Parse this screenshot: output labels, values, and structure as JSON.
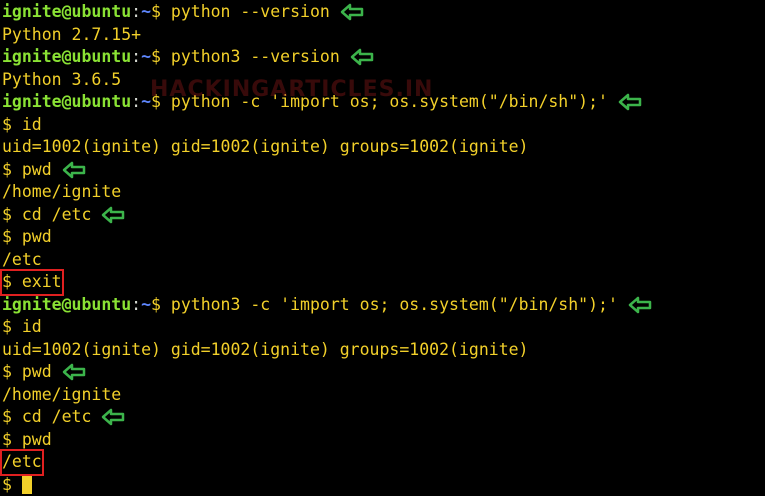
{
  "terminal": {
    "watermark": "HACKINGARTICLES.IN",
    "prompt_user": "ignite@ubuntu",
    "prompt_colon": ":",
    "prompt_path": "~",
    "prompt_dollar": "$ ",
    "lines": [
      {
        "type": "prompt",
        "cmd": "python --version",
        "arrow": true
      },
      {
        "type": "out",
        "text": "Python 2.7.15+"
      },
      {
        "type": "prompt",
        "cmd": "python3 --version",
        "arrow": true
      },
      {
        "type": "out",
        "text": "Python 3.6.5"
      },
      {
        "type": "prompt",
        "cmd": "python -c 'import os; os.system(\"/bin/sh\");'",
        "arrow": true
      },
      {
        "type": "out",
        "text": "$ id"
      },
      {
        "type": "out",
        "text": "uid=1002(ignite) gid=1002(ignite) groups=1002(ignite)"
      },
      {
        "type": "out",
        "text": "$ pwd",
        "arrow": true
      },
      {
        "type": "out",
        "text": "/home/ignite"
      },
      {
        "type": "out",
        "text": "$ cd /etc",
        "arrow": true
      },
      {
        "type": "out",
        "text": "$ pwd"
      },
      {
        "type": "out",
        "text": "/etc"
      },
      {
        "type": "out",
        "text": "$ exit",
        "highlight": true
      },
      {
        "type": "prompt",
        "cmd": "python3 -c 'import os; os.system(\"/bin/sh\");'",
        "arrow": true
      },
      {
        "type": "out",
        "text": "$ id"
      },
      {
        "type": "out",
        "text": "uid=1002(ignite) gid=1002(ignite) groups=1002(ignite)"
      },
      {
        "type": "out",
        "text": "$ pwd",
        "arrow": true
      },
      {
        "type": "out",
        "text": "/home/ignite"
      },
      {
        "type": "out",
        "text": "$ cd /etc",
        "arrow": true
      },
      {
        "type": "out",
        "text": "$ pwd"
      },
      {
        "type": "out",
        "text": "/etc",
        "highlight": true
      },
      {
        "type": "cursor",
        "text": "$"
      }
    ]
  },
  "colors": {
    "background": "#000000",
    "text": "#f2d02a",
    "user": "#8ae234",
    "path": "#5f87ff",
    "arrow": "#3cb44b",
    "highlight_box": "#e02020"
  }
}
